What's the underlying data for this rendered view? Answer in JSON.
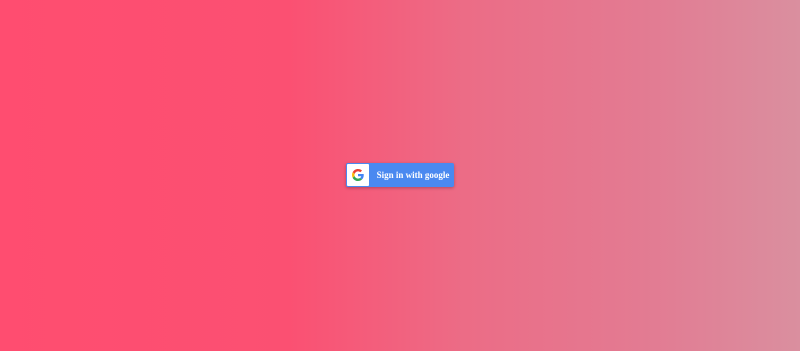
{
  "page": {
    "background_colors": [
      "#ff4d70",
      "#fb5072",
      "#ec6c86",
      "#e27c93",
      "#da8f9f"
    ]
  },
  "signin_button": {
    "label": "Sign in with google",
    "icon": "google-g-icon",
    "button_color": "#4a89f0",
    "icon_background": "#ffffff",
    "text_color": "#ffffff"
  }
}
